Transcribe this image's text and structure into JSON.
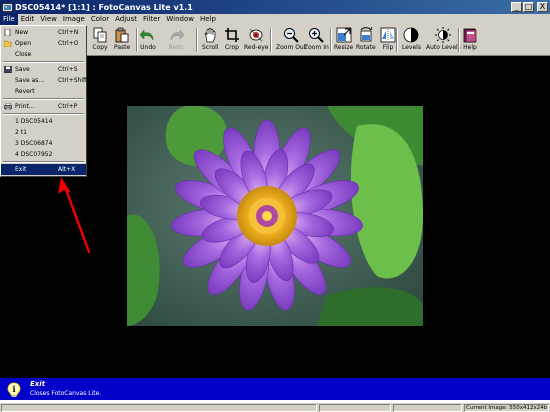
{
  "window": {
    "title": "DSC05414* [1:1] : FotoCanvas Lite v1.1",
    "minimize": "_",
    "maximize": "□",
    "close": "X"
  },
  "menubar": [
    "File",
    "Edit",
    "View",
    "Image",
    "Color",
    "Adjust",
    "Filter",
    "Window",
    "Help"
  ],
  "file_menu": {
    "new": {
      "label": "New",
      "shortcut": "Ctrl+N"
    },
    "open": {
      "label": "Open",
      "shortcut": "Ctrl+O"
    },
    "close": {
      "label": "Close"
    },
    "save": {
      "label": "Save",
      "shortcut": "Ctrl+S"
    },
    "save_as": {
      "label": "Save as...",
      "shortcut": "Ctrl+Shift+S"
    },
    "revert": {
      "label": "Revert"
    },
    "print": {
      "label": "Print...",
      "shortcut": "Ctrl+P"
    },
    "recent": [
      "1 DSC05414",
      "2 t1",
      "3 DSC06874",
      "4 DSC07952"
    ],
    "exit": {
      "label": "Exit",
      "shortcut": "Alt+X"
    }
  },
  "toolbar": {
    "copy": "Copy",
    "paste": "Paste",
    "undo": "Undo",
    "redo": "Redo",
    "scroll": "Scroll",
    "crop": "Crop",
    "redeye": "Red-eye",
    "zoom_out": "Zoom Out",
    "zoom_in": "Zoom In",
    "resize": "Resize",
    "rotate": "Rotate",
    "flip": "Flip",
    "levels": "Levels",
    "auto_levels": "Auto Levels",
    "help": "Help"
  },
  "hint": {
    "title": "Exit",
    "description": "Closes FotoCanvas Lite."
  },
  "status": {
    "current_image": "Current Image: 550x412x24b"
  },
  "colors": {
    "titlebar": "#0a246a",
    "highlight": "#0a246a",
    "hintbar": "#0000c8",
    "face": "#d4d0c8",
    "arrow": "#ee0000"
  },
  "icons": [
    "app-icon",
    "new-icon",
    "open-icon",
    "save-icon",
    "print-icon",
    "copy-icon",
    "paste-icon",
    "undo-icon",
    "redo-icon",
    "scroll-icon",
    "crop-icon",
    "redeye-icon",
    "zoom-out-icon",
    "zoom-in-icon",
    "resize-icon",
    "rotate-icon",
    "flip-icon",
    "levels-icon",
    "auto-levels-icon",
    "help-icon",
    "info-icon"
  ]
}
